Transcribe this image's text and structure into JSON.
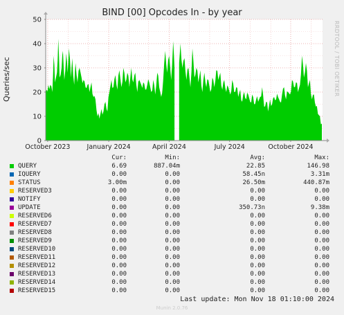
{
  "title": "BIND [00] Opcodes In - by year",
  "side_label": "RRDTOOL / TOBI OETIKER",
  "footer_version": "Munin 2.0.76",
  "last_update": "Last update: Mon Nov 18 01:10:00 2024",
  "table_headers": {
    "cur": "Cur:",
    "min": "Min:",
    "avg": "Avg:",
    "max": "Max:"
  },
  "legend": [
    {
      "name": "QUERY",
      "color": "#00cc00",
      "cur": "6.69",
      "min": "887.04m",
      "avg": "22.85",
      "max": "146.98"
    },
    {
      "name": "IQUERY",
      "color": "#0066b3",
      "cur": "0.00",
      "min": "0.00",
      "avg": "58.45n",
      "max": "3.31m"
    },
    {
      "name": "STATUS",
      "color": "#ff8000",
      "cur": "3.00m",
      "min": "0.00",
      "avg": "26.50m",
      "max": "440.87m"
    },
    {
      "name": "RESERVED3",
      "color": "#ffcc00",
      "cur": "0.00",
      "min": "0.00",
      "avg": "0.00",
      "max": "0.00"
    },
    {
      "name": "NOTIFY",
      "color": "#330099",
      "cur": "0.00",
      "min": "0.00",
      "avg": "0.00",
      "max": "0.00"
    },
    {
      "name": "UPDATE",
      "color": "#990099",
      "cur": "0.00",
      "min": "0.00",
      "avg": "350.73n",
      "max": "9.38m"
    },
    {
      "name": "RESERVED6",
      "color": "#ccff00",
      "cur": "0.00",
      "min": "0.00",
      "avg": "0.00",
      "max": "0.00"
    },
    {
      "name": "RESERVED7",
      "color": "#ff0000",
      "cur": "0.00",
      "min": "0.00",
      "avg": "0.00",
      "max": "0.00"
    },
    {
      "name": "RESERVED8",
      "color": "#808080",
      "cur": "0.00",
      "min": "0.00",
      "avg": "0.00",
      "max": "0.00"
    },
    {
      "name": "RESERVED9",
      "color": "#008f00",
      "cur": "0.00",
      "min": "0.00",
      "avg": "0.00",
      "max": "0.00"
    },
    {
      "name": "RESERVED10",
      "color": "#00487d",
      "cur": "0.00",
      "min": "0.00",
      "avg": "0.00",
      "max": "0.00"
    },
    {
      "name": "RESERVED11",
      "color": "#b35a00",
      "cur": "0.00",
      "min": "0.00",
      "avg": "0.00",
      "max": "0.00"
    },
    {
      "name": "RESERVED12",
      "color": "#b38f00",
      "cur": "0.00",
      "min": "0.00",
      "avg": "0.00",
      "max": "0.00"
    },
    {
      "name": "RESERVED13",
      "color": "#6b006b",
      "cur": "0.00",
      "min": "0.00",
      "avg": "0.00",
      "max": "0.00"
    },
    {
      "name": "RESERVED14",
      "color": "#8fb300",
      "cur": "0.00",
      "min": "0.00",
      "avg": "0.00",
      "max": "0.00"
    },
    {
      "name": "RESERVED15",
      "color": "#b30000",
      "cur": "0.00",
      "min": "0.00",
      "avg": "0.00",
      "max": "0.00"
    }
  ],
  "chart_data": {
    "type": "area",
    "title": "BIND [00] Opcodes In - by year",
    "ylabel": "Queries/sec",
    "xlabel": "",
    "ylim": [
      0,
      50
    ],
    "xlim": [
      "2023-09-28",
      "2024-11-18"
    ],
    "y_ticks": [
      0,
      10,
      20,
      30,
      40,
      50
    ],
    "x_ticks": [
      {
        "date": "2023-10-01",
        "label": "October 2023"
      },
      {
        "date": "2024-01-01",
        "label": "January 2024"
      },
      {
        "date": "2024-04-01",
        "label": "April 2024"
      },
      {
        "date": "2024-07-01",
        "label": "July 2024"
      },
      {
        "date": "2024-10-01",
        "label": "October 2024"
      }
    ],
    "grid": true,
    "series": [
      {
        "name": "QUERY",
        "color": "#00cc00",
        "gaps": [
          [
            "2024-04-10",
            "2024-04-15"
          ]
        ],
        "points": [
          [
            "2023-09-28",
            20
          ],
          [
            "2023-10-02",
            23
          ],
          [
            "2023-10-05",
            23
          ],
          [
            "2023-10-08",
            20
          ],
          [
            "2023-10-10",
            35
          ],
          [
            "2023-10-12",
            24
          ],
          [
            "2023-10-15",
            28
          ],
          [
            "2023-10-17",
            42
          ],
          [
            "2023-10-19",
            26
          ],
          [
            "2023-10-22",
            30
          ],
          [
            "2023-10-24",
            37
          ],
          [
            "2023-10-26",
            25
          ],
          [
            "2023-10-29",
            36
          ],
          [
            "2023-10-31",
            28
          ],
          [
            "2023-11-02",
            38
          ],
          [
            "2023-11-05",
            26
          ],
          [
            "2023-11-07",
            34
          ],
          [
            "2023-11-10",
            23
          ],
          [
            "2023-11-12",
            32
          ],
          [
            "2023-11-15",
            24
          ],
          [
            "2023-11-18",
            30
          ],
          [
            "2023-11-21",
            26
          ],
          [
            "2023-11-24",
            25
          ],
          [
            "2023-11-27",
            22
          ],
          [
            "2023-11-30",
            23
          ],
          [
            "2023-12-03",
            20
          ],
          [
            "2023-12-06",
            24
          ],
          [
            "2023-12-09",
            18
          ],
          [
            "2023-12-12",
            17
          ],
          [
            "2023-12-15",
            10
          ],
          [
            "2023-12-18",
            9
          ],
          [
            "2023-12-21",
            13
          ],
          [
            "2023-12-24",
            12
          ],
          [
            "2023-12-27",
            16
          ],
          [
            "2023-12-30",
            12
          ],
          [
            "2024-01-02",
            20
          ],
          [
            "2024-01-05",
            25
          ],
          [
            "2024-01-08",
            22
          ],
          [
            "2024-01-11",
            27
          ],
          [
            "2024-01-14",
            21
          ],
          [
            "2024-01-17",
            29
          ],
          [
            "2024-01-20",
            22
          ],
          [
            "2024-01-23",
            30
          ],
          [
            "2024-01-26",
            24
          ],
          [
            "2024-01-29",
            28
          ],
          [
            "2024-02-01",
            22
          ],
          [
            "2024-02-04",
            30
          ],
          [
            "2024-02-07",
            24
          ],
          [
            "2024-02-10",
            28
          ],
          [
            "2024-02-13",
            20
          ],
          [
            "2024-02-16",
            25
          ],
          [
            "2024-02-19",
            23
          ],
          [
            "2024-02-22",
            24
          ],
          [
            "2024-02-25",
            21
          ],
          [
            "2024-02-28",
            23
          ],
          [
            "2024-03-02",
            24
          ],
          [
            "2024-03-05",
            20
          ],
          [
            "2024-03-08",
            25
          ],
          [
            "2024-03-11",
            19
          ],
          [
            "2024-03-14",
            28
          ],
          [
            "2024-03-17",
            22
          ],
          [
            "2024-03-20",
            18
          ],
          [
            "2024-03-23",
            25
          ],
          [
            "2024-03-26",
            37
          ],
          [
            "2024-03-29",
            28
          ],
          [
            "2024-04-01",
            35
          ],
          [
            "2024-04-04",
            25
          ],
          [
            "2024-04-07",
            41
          ],
          [
            "2024-04-09",
            30
          ],
          [
            "2024-04-16",
            32
          ],
          [
            "2024-04-18",
            40
          ],
          [
            "2024-04-21",
            30
          ],
          [
            "2024-04-24",
            34
          ],
          [
            "2024-04-27",
            25
          ],
          [
            "2024-04-30",
            30
          ],
          [
            "2024-05-03",
            22
          ],
          [
            "2024-05-06",
            38
          ],
          [
            "2024-05-09",
            26
          ],
          [
            "2024-05-12",
            30
          ],
          [
            "2024-05-15",
            24
          ],
          [
            "2024-05-18",
            29
          ],
          [
            "2024-05-21",
            20
          ],
          [
            "2024-05-24",
            28
          ],
          [
            "2024-05-27",
            22
          ],
          [
            "2024-05-30",
            25
          ],
          [
            "2024-06-02",
            20
          ],
          [
            "2024-06-05",
            26
          ],
          [
            "2024-06-08",
            22
          ],
          [
            "2024-06-11",
            29
          ],
          [
            "2024-06-14",
            25
          ],
          [
            "2024-06-17",
            28
          ],
          [
            "2024-06-20",
            21
          ],
          [
            "2024-06-23",
            25
          ],
          [
            "2024-06-26",
            20
          ],
          [
            "2024-06-29",
            22
          ],
          [
            "2024-07-02",
            19
          ],
          [
            "2024-07-05",
            25
          ],
          [
            "2024-07-08",
            20
          ],
          [
            "2024-07-11",
            22
          ],
          [
            "2024-07-14",
            18
          ],
          [
            "2024-07-17",
            21
          ],
          [
            "2024-07-20",
            16
          ],
          [
            "2024-07-23",
            20
          ],
          [
            "2024-07-26",
            17
          ],
          [
            "2024-07-29",
            19
          ],
          [
            "2024-08-01",
            16
          ],
          [
            "2024-08-04",
            19
          ],
          [
            "2024-08-07",
            15
          ],
          [
            "2024-08-10",
            17
          ],
          [
            "2024-08-13",
            16
          ],
          [
            "2024-08-16",
            18
          ],
          [
            "2024-08-19",
            22
          ],
          [
            "2024-08-22",
            14
          ],
          [
            "2024-08-25",
            16
          ],
          [
            "2024-08-28",
            12
          ],
          [
            "2024-08-31",
            17
          ],
          [
            "2024-09-03",
            15
          ],
          [
            "2024-09-06",
            18
          ],
          [
            "2024-09-09",
            17
          ],
          [
            "2024-09-12",
            18
          ],
          [
            "2024-09-15",
            16
          ],
          [
            "2024-09-18",
            19
          ],
          [
            "2024-09-21",
            22
          ],
          [
            "2024-09-24",
            17
          ],
          [
            "2024-09-27",
            20
          ],
          [
            "2024-09-30",
            19
          ],
          [
            "2024-10-03",
            25
          ],
          [
            "2024-10-06",
            22
          ],
          [
            "2024-10-09",
            24
          ],
          [
            "2024-10-12",
            20
          ],
          [
            "2024-10-15",
            23
          ],
          [
            "2024-10-18",
            35
          ],
          [
            "2024-10-21",
            26
          ],
          [
            "2024-10-24",
            32
          ],
          [
            "2024-10-27",
            22
          ],
          [
            "2024-10-30",
            25
          ],
          [
            "2024-11-02",
            17
          ],
          [
            "2024-11-05",
            19
          ],
          [
            "2024-11-08",
            14
          ],
          [
            "2024-11-11",
            11
          ],
          [
            "2024-11-14",
            10
          ],
          [
            "2024-11-17",
            7
          ]
        ]
      }
    ]
  }
}
